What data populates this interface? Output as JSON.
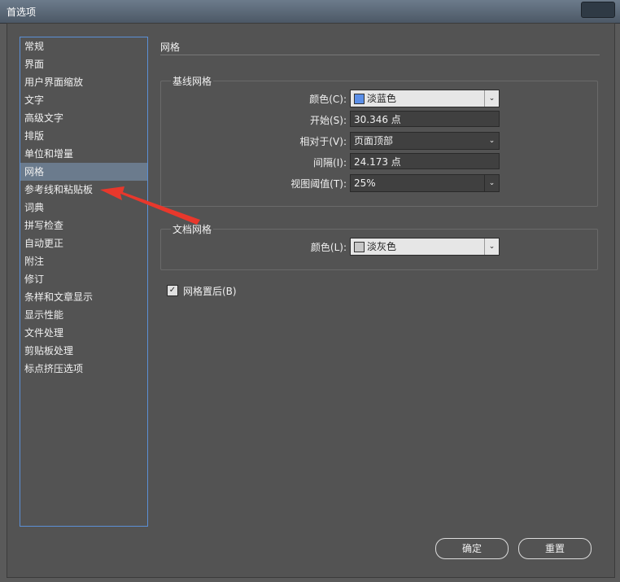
{
  "window": {
    "title": "首选项"
  },
  "sidebar": {
    "items": [
      {
        "label": "常规",
        "selected": false
      },
      {
        "label": "界面",
        "selected": false
      },
      {
        "label": "用户界面缩放",
        "selected": false
      },
      {
        "label": "文字",
        "selected": false
      },
      {
        "label": "高级文字",
        "selected": false
      },
      {
        "label": "排版",
        "selected": false
      },
      {
        "label": "单位和增量",
        "selected": false
      },
      {
        "label": "网格",
        "selected": true
      },
      {
        "label": "参考线和粘贴板",
        "selected": false
      },
      {
        "label": "词典",
        "selected": false
      },
      {
        "label": "拼写检查",
        "selected": false
      },
      {
        "label": "自动更正",
        "selected": false
      },
      {
        "label": "附注",
        "selected": false
      },
      {
        "label": "修订",
        "selected": false
      },
      {
        "label": "条样和文章显示",
        "selected": false
      },
      {
        "label": "显示性能",
        "selected": false
      },
      {
        "label": "文件处理",
        "selected": false
      },
      {
        "label": "剪贴板处理",
        "selected": false
      },
      {
        "label": "标点挤压选项",
        "selected": false
      }
    ]
  },
  "main": {
    "section_title": "网格",
    "baseline": {
      "title": "基线网格",
      "color_label": "颜色(C):",
      "color_value": "淡蓝色",
      "color_swatch": "#5b8fe8",
      "start_label": "开始(S):",
      "start_value": "30.346 点",
      "relative_label": "相对于(V):",
      "relative_value": "页面顶部",
      "interval_label": "间隔(I):",
      "interval_value": "24.173 点",
      "threshold_label": "视图阈值(T):",
      "threshold_value": "25%"
    },
    "document": {
      "title": "文档网格",
      "color_label": "颜色(L):",
      "color_value": "淡灰色",
      "color_swatch": "#c8c8c8"
    },
    "grid_back": {
      "label": "网格置后(B)",
      "checked": true
    }
  },
  "buttons": {
    "ok": "确定",
    "reset": "重置"
  }
}
